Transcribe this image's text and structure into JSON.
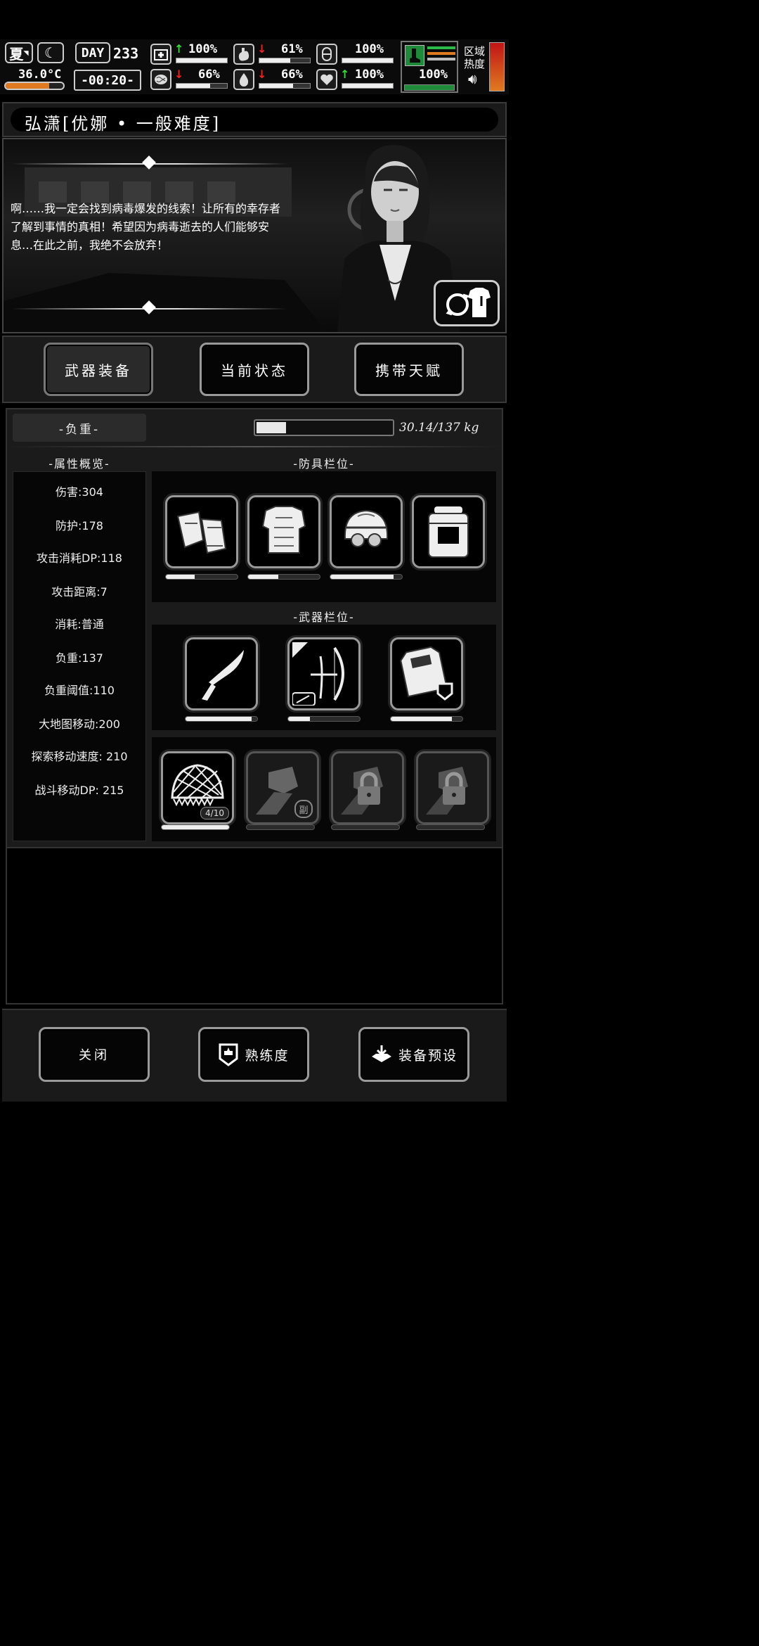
{
  "hud": {
    "season": "夏",
    "day_label": "DAY",
    "day": "233",
    "temperature": "36.0°C",
    "time": "-00:20-",
    "health": {
      "value": "100%",
      "trend": "up",
      "level": 1.0
    },
    "hunger": {
      "value": "61%",
      "trend": "down",
      "level": 0.61
    },
    "stamina": {
      "value": "100%",
      "level": 1.0
    },
    "sanity": {
      "value": "66%",
      "trend": "down",
      "level": 0.66
    },
    "thirst": {
      "value": "66%",
      "trend": "down",
      "level": 0.66
    },
    "heart": {
      "value": "100%",
      "trend": "up",
      "level": 1.0
    },
    "boot": {
      "value": "100%",
      "level": 1.0
    },
    "zone_heat_label_1": "区域",
    "zone_heat_label_2": "热度",
    "temperature_level": 0.75
  },
  "character": {
    "title": "弘潇[优娜 • 一般难度]",
    "quote": "啊……我一定会找到病毒爆发的线索！让所有的幸存者了解到事情的真相！希望因为病毒逝去的人们能够安息…在此之前，我绝不会放弃！"
  },
  "tabs": [
    {
      "label": "武器装备",
      "selected": true
    },
    {
      "label": "当前状态",
      "selected": false
    },
    {
      "label": "携带天赋",
      "selected": false
    }
  ],
  "load": {
    "label": "-负重-",
    "value": "30.14/137 kg",
    "level": 0.22
  },
  "stats": {
    "title": "-属性概览-",
    "items": [
      "伤害:304",
      "防护:178",
      "攻击消耗DP:118",
      "攻击距离:7",
      "消耗:普通",
      "负重:137",
      "负重阈值:110",
      "大地图移动:200",
      "探索移动速度: 210",
      "战斗移动DP: 215"
    ]
  },
  "armor": {
    "title": "-防具栏位-",
    "slots": [
      {
        "icon": "gloves-icon",
        "durability": 0.4
      },
      {
        "icon": "body-armor-icon",
        "durability": 0.42
      },
      {
        "icon": "helmet-icon",
        "durability": 0.88
      },
      {
        "icon": "backpack-icon",
        "durability": 0.0
      }
    ]
  },
  "weapons": {
    "title": "-武器栏位-",
    "slots": [
      {
        "icon": "machete-icon",
        "durability": 0.92
      },
      {
        "icon": "bow-icon",
        "durability": 0.3
      },
      {
        "icon": "riot-shield-icon",
        "durability": 0.85
      }
    ]
  },
  "extra": {
    "slots": [
      {
        "icon": "net-icon",
        "badge": "4/10",
        "durability": 1.0
      },
      {
        "icon": "fist-icon",
        "badge": "副",
        "durability": 0.0
      },
      {
        "icon": "locked-icon",
        "durability": 0.0
      },
      {
        "icon": "locked-icon",
        "durability": 0.0
      }
    ]
  },
  "footer": {
    "close": "关闭",
    "proficiency": "熟练度",
    "preset": "装备预设"
  }
}
